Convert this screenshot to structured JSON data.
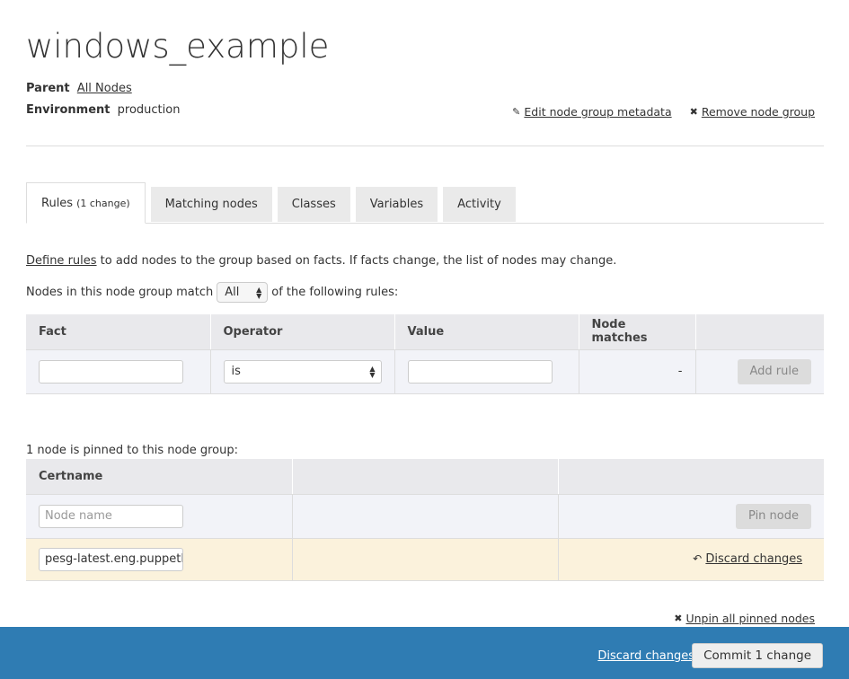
{
  "page": {
    "title": "windows_example",
    "parent_label": "Parent",
    "parent_value": "All Nodes",
    "environment_label": "Environment",
    "environment_value": "production"
  },
  "header_actions": {
    "edit_label": "Edit node group metadata",
    "edit_icon": "pencil-icon",
    "remove_label": "Remove node group",
    "remove_icon": "x-icon"
  },
  "tabs": [
    {
      "label": "Rules",
      "badge": "(1 change)",
      "active": true
    },
    {
      "label": "Matching nodes",
      "active": false
    },
    {
      "label": "Classes",
      "active": false
    },
    {
      "label": "Variables",
      "active": false
    },
    {
      "label": "Activity",
      "active": false
    }
  ],
  "rules": {
    "intro_link": "Define rules",
    "intro_text": " to add nodes to the group based on facts. If facts change, the list of nodes may change.",
    "match_prefix": "Nodes in this node group match",
    "match_value": "All",
    "match_suffix": "of the following rules:",
    "columns": [
      "Fact",
      "Operator",
      "Value",
      "Node matches",
      ""
    ],
    "new_rule": {
      "fact": "",
      "operator": "is",
      "value": "",
      "node_matches": "-",
      "add_button": "Add rule"
    }
  },
  "pinned": {
    "summary": "1 node is pinned to this node group:",
    "columns": [
      "Certname",
      "",
      ""
    ],
    "input_placeholder": "Node name",
    "pin_button": "Pin node",
    "nodes": [
      {
        "certname": "pesg-latest.eng.puppetla",
        "action": "Discard changes",
        "action_icon": "undo-icon"
      }
    ],
    "unpin_all": "Unpin all pinned nodes"
  },
  "footer": {
    "discard": "Discard changes",
    "commit": "Commit 1 change"
  },
  "colors": {
    "footer_bg": "#2f7cb3",
    "changed_row_bg": "#fbf2dc",
    "table_header_bg": "#e9e9ec"
  }
}
